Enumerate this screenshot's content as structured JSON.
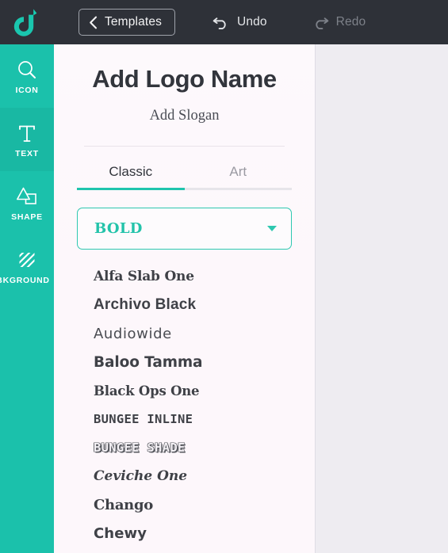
{
  "topbar": {
    "logo_icon": "app-logo-icon",
    "templates_label": "Templates",
    "back_icon": "chevron-left-icon",
    "undo_label": "Undo",
    "undo_icon": "undo-arrow-icon",
    "redo_label": "Redo",
    "redo_icon": "redo-arrow-icon",
    "background_color": "#2e3138"
  },
  "sidebar": {
    "accent_color": "#1bc1ab",
    "active_color": "#19b8a3",
    "items": [
      {
        "label": "ICON",
        "icon": "magnifier-icon",
        "active": false
      },
      {
        "label": "TEXT",
        "icon": "text-t-icon",
        "active": true
      },
      {
        "label": "SHAPE",
        "icon": "shapes-icon",
        "active": false
      },
      {
        "label": "BKGROUND",
        "icon": "hatch-pattern-icon",
        "active": false
      }
    ]
  },
  "panel": {
    "logo_name": "Add Logo Name",
    "slogan": "Add Slogan",
    "tabs": [
      {
        "label": "Classic",
        "active": true
      },
      {
        "label": "Art",
        "active": false
      }
    ],
    "style_dropdown": {
      "value": "BOLD",
      "caret_icon": "chevron-down-icon",
      "border_color": "#2ec8b0",
      "text_color": "#23c3aa"
    },
    "font_list": [
      {
        "name": "Alfa Slab One",
        "style": "f-slab"
      },
      {
        "name": "Archivo Black",
        "style": "f-black"
      },
      {
        "name": "Audiowide",
        "style": "f-wide"
      },
      {
        "name": "Baloo Tamma",
        "style": "f-round"
      },
      {
        "name": "Black Ops One",
        "style": "f-ops"
      },
      {
        "name": "BUNGEE INLINE",
        "style": "f-inline"
      },
      {
        "name": "BUNGEE SHADE",
        "style": "f-shade"
      },
      {
        "name": "Ceviche One",
        "style": "f-italic"
      },
      {
        "name": "Chango",
        "style": "f-chango"
      },
      {
        "name": "Chewy",
        "style": "f-chewy"
      }
    ]
  }
}
